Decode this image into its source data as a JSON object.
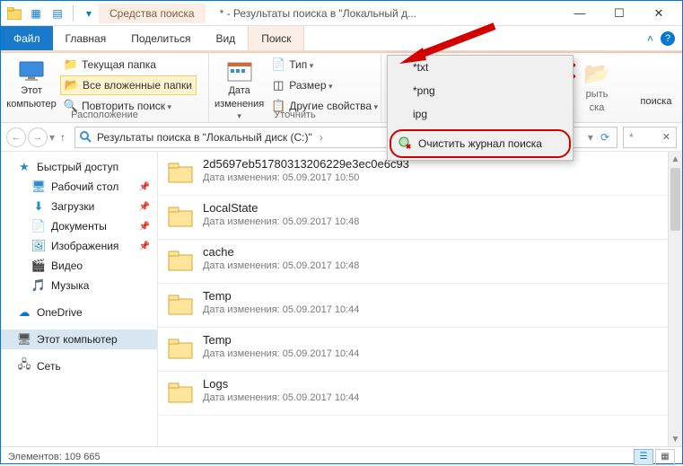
{
  "titlebar": {
    "context_tab": "Средства поиска",
    "title": "* - Результаты поиска в \"Локальный д..."
  },
  "tabs": {
    "file": "Файл",
    "home": "Главная",
    "share": "Поделиться",
    "view": "Вид",
    "search": "Поиск"
  },
  "ribbon": {
    "this_pc_line1": "Этот",
    "this_pc_line2": "компьютер",
    "current_folder": "Текущая папка",
    "all_subfolders": "Все вложенные папки",
    "repeat_search": "Повторить поиск",
    "group_location": "Расположение",
    "date_mod_line1": "Дата",
    "date_mod_line2": "изменения",
    "type": "Тип",
    "size": "Размер",
    "other_props": "Другие свойства",
    "group_refine": "Уточнить",
    "open_label": "рыть",
    "close_search_line1": "ска",
    "close_search_line2": "поиска"
  },
  "recent_menu": {
    "items": [
      "*txt",
      "*png",
      "ipg"
    ],
    "clear": "Очистить журнал поиска"
  },
  "address": {
    "crumb": "Результаты поиска в \"Локальный диск (C:)\"",
    "search_placeholder": "*"
  },
  "sidebar": {
    "quick": "Быстрый доступ",
    "desktop": "Рабочий стол",
    "downloads": "Загрузки",
    "documents": "Документы",
    "pictures": "Изображения",
    "videos": "Видео",
    "music": "Музыка",
    "onedrive": "OneDrive",
    "this_pc": "Этот компьютер",
    "network": "Сеть"
  },
  "files": [
    {
      "name": "2d5697eb51780313206229e3ec0e6c93",
      "mod_label": "Дата изменения:",
      "mod": "05.09.2017 10:50"
    },
    {
      "name": "LocalState",
      "mod_label": "Дата изменения:",
      "mod": "05.09.2017 10:48"
    },
    {
      "name": "cache",
      "mod_label": "Дата изменения:",
      "mod": "05.09.2017 10:48"
    },
    {
      "name": "Temp",
      "mod_label": "Дата изменения:",
      "mod": "05.09.2017 10:44"
    },
    {
      "name": "Temp",
      "mod_label": "Дата изменения:",
      "mod": "05.09.2017 10:44"
    },
    {
      "name": "Logs",
      "mod_label": "Дата изменения:",
      "mod": "05.09.2017 10:44"
    }
  ],
  "status": {
    "elements": "Элементов: 109 665"
  }
}
